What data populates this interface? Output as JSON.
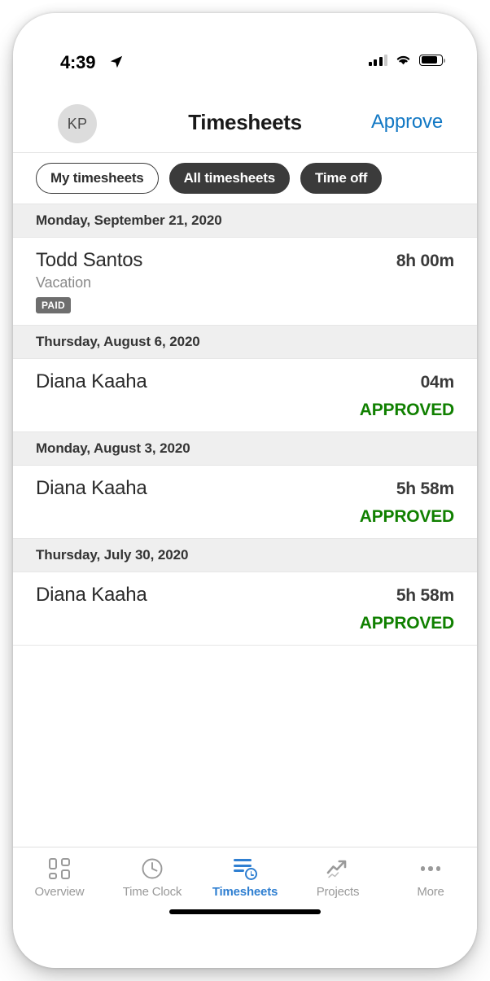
{
  "status_bar": {
    "time": "4:39",
    "location_icon": "location-arrow-icon",
    "signal_icon": "cellular-signal-icon",
    "wifi_icon": "wifi-icon",
    "battery_icon": "battery-icon"
  },
  "header": {
    "avatar_initials": "KP",
    "title": "Timesheets",
    "approve_label": "Approve"
  },
  "filters": [
    {
      "label": "My timesheets",
      "active": false
    },
    {
      "label": "All timesheets",
      "active": true
    },
    {
      "label": "Time off",
      "active": true
    }
  ],
  "sections": [
    {
      "date": "Monday, September 21, 2020",
      "entries": [
        {
          "name": "Todd Santos",
          "duration": "8h 00m",
          "subtitle": "Vacation",
          "badge": "PAID",
          "status": ""
        }
      ]
    },
    {
      "date": "Thursday, August 6, 2020",
      "entries": [
        {
          "name": "Diana Kaaha",
          "duration": "04m",
          "subtitle": "",
          "badge": "",
          "status": "APPROVED"
        }
      ]
    },
    {
      "date": "Monday, August 3, 2020",
      "entries": [
        {
          "name": "Diana Kaaha",
          "duration": "5h 58m",
          "subtitle": "",
          "badge": "",
          "status": "APPROVED"
        }
      ]
    },
    {
      "date": "Thursday, July 30, 2020",
      "entries": [
        {
          "name": "Diana Kaaha",
          "duration": "5h 58m",
          "subtitle": "",
          "badge": "",
          "status": "APPROVED"
        }
      ]
    }
  ],
  "tabs": [
    {
      "label": "Overview",
      "icon": "grid-icon",
      "active": false
    },
    {
      "label": "Time Clock",
      "icon": "clock-icon",
      "active": false
    },
    {
      "label": "Timesheets",
      "icon": "timesheet-icon",
      "active": true
    },
    {
      "label": "Projects",
      "icon": "trending-up-icon",
      "active": false
    },
    {
      "label": "More",
      "icon": "ellipsis-icon",
      "active": false
    }
  ],
  "colors": {
    "accent_blue": "#1278c4",
    "tab_active_blue": "#2f7fd1",
    "approved_green": "#108000",
    "badge_gray": "#6e6e6e",
    "section_gray": "#efefef",
    "chip_dark": "#3b3b3b"
  }
}
